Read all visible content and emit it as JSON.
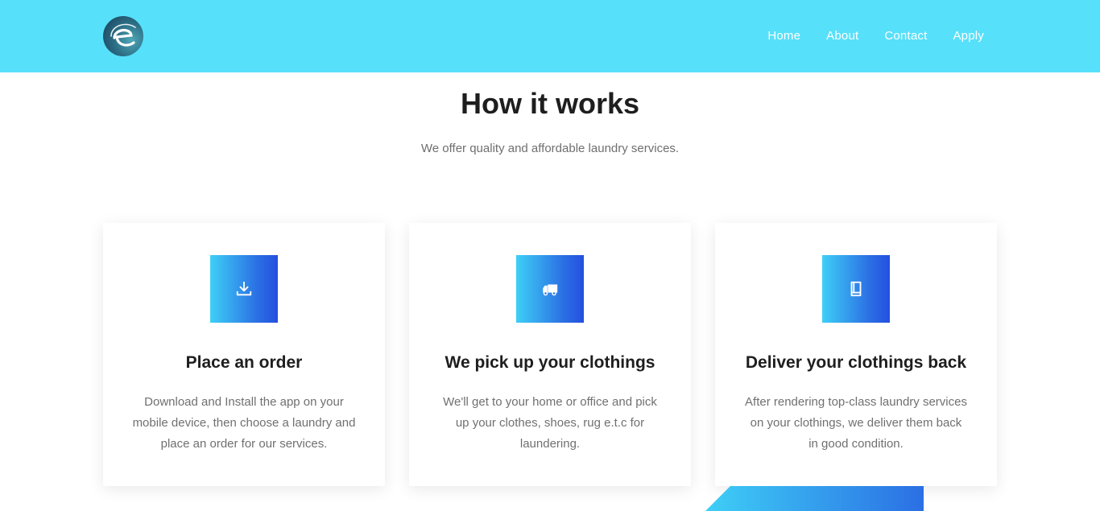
{
  "header": {
    "logo_icon": "e-logo-icon",
    "nav": [
      {
        "label": "Home"
      },
      {
        "label": "About"
      },
      {
        "label": "Contact"
      },
      {
        "label": "Apply"
      }
    ],
    "background": "#57e0fa"
  },
  "section": {
    "title": "How it works",
    "subtitle": "We offer quality and affordable laundry services."
  },
  "cards": [
    {
      "icon": "download-icon",
      "title": "Place an order",
      "text": "Download and Install the app on your mobile device, then choose a laundry and place an order for our services."
    },
    {
      "icon": "truck-icon",
      "title": "We pick up your clothings",
      "text": "We'll get to your home or office and pick up your clothes, shoes, rug e.t.c for laundering."
    },
    {
      "icon": "book-icon",
      "title": "Deliver your clothings back",
      "text": "After rendering top-class laundry services on your clothings, we deliver them back in good condition."
    }
  ],
  "colors": {
    "accent_start": "#3ecff6",
    "accent_end": "#2450df",
    "heading": "#1e1e1e",
    "body_text": "#707070"
  }
}
